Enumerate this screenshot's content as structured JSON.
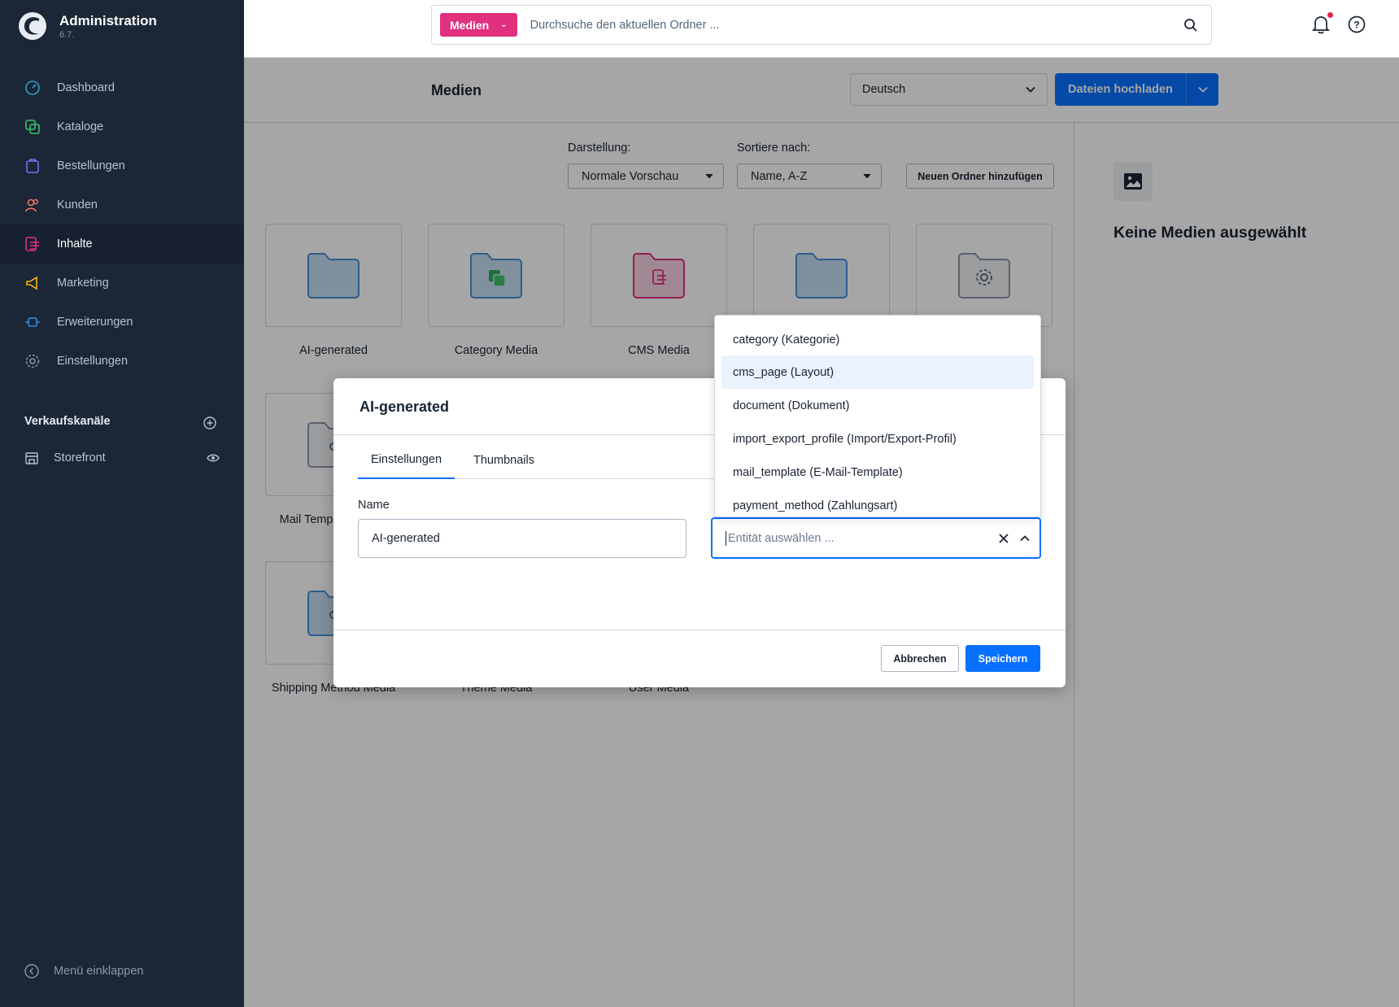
{
  "app": {
    "title": "Administration",
    "version": "6.7."
  },
  "sidebar": {
    "items": [
      {
        "label": "Dashboard",
        "icon": "dashboard-icon",
        "color": "#2ea0c6"
      },
      {
        "label": "Kataloge",
        "icon": "catalog-icon",
        "color": "#3ec26b"
      },
      {
        "label": "Bestellungen",
        "icon": "orders-icon",
        "color": "#7a6ef0"
      },
      {
        "label": "Kunden",
        "icon": "customers-icon",
        "color": "#f07a5e"
      },
      {
        "label": "Inhalte",
        "icon": "content-icon",
        "color": "#e0307e"
      },
      {
        "label": "Marketing",
        "icon": "marketing-icon",
        "color": "#f5b614"
      },
      {
        "label": "Erweiterungen",
        "icon": "extensions-icon",
        "color": "#2e8fe0"
      },
      {
        "label": "Einstellungen",
        "icon": "settings-icon",
        "color": "#8a97aa"
      }
    ],
    "sales_channels_title": "Verkaufskanäle",
    "channel": "Storefront",
    "collapse_label": "Menü einklappen"
  },
  "topbar": {
    "scope": "Medien",
    "search_placeholder": "Durchsuche den aktuellen Ordner ..."
  },
  "smartbar": {
    "title": "Medien",
    "language": "Deutsch",
    "upload_label": "Dateien hochladen"
  },
  "toolbar": {
    "view_label": "Darstellung:",
    "view_value": "Normale Vorschau",
    "sort_label": "Sortiere nach:",
    "sort_value": "Name, A-Z",
    "new_folder": "Neuen Ordner hinzufügen"
  },
  "folders": [
    {
      "name": "AI-generated"
    },
    {
      "name": "Category Media"
    },
    {
      "name": "CMS Media"
    },
    {
      "name": "Mail Template Media"
    },
    {
      "name": "Shipping Method Media"
    },
    {
      "name": "Theme Media"
    },
    {
      "name": "User Media"
    }
  ],
  "right_panel": {
    "empty_title": "Keine Medien ausgewählt"
  },
  "modal": {
    "title": "AI-generated",
    "tabs": [
      "Einstellungen",
      "Thumbnails"
    ],
    "name_label": "Name",
    "name_value": "AI-generated",
    "entity_placeholder": "Entität auswählen ...",
    "cancel": "Abbrechen",
    "save": "Speichern"
  },
  "dropdown": {
    "options": [
      "category (Kategorie)",
      "cms_page (Layout)",
      "document (Dokument)",
      "import_export_profile (Import/Export-Profil)",
      "mail_template (E-Mail-Template)",
      "payment_method (Zahlungsart)"
    ],
    "highlighted_index": 1
  },
  "colors": {
    "sidebar_bg": "#1b2637",
    "primary": "#0870ff",
    "scope_pink": "#e0307e",
    "folder_blue": "#4a90d9",
    "notification_dot": "#de294c"
  }
}
